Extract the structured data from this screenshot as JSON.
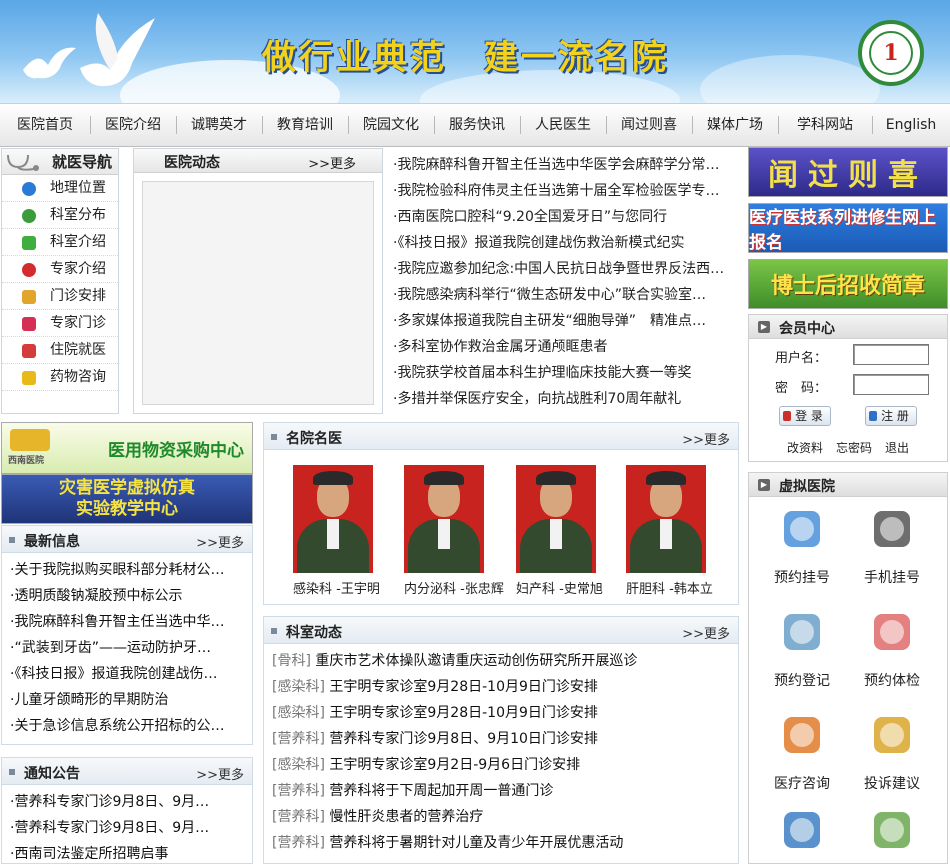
{
  "banner": {
    "slogan": "做行业典范　建一流名院"
  },
  "nav": [
    "医院首页",
    "医院介绍",
    "诚聘英才",
    "教育培训",
    "院园文化",
    "服务快讯",
    "人民医生",
    "闻过则喜",
    "媒体广场",
    "学科网站",
    "English"
  ],
  "sidebar": {
    "title": "就医导航",
    "items": [
      {
        "label": "地理位置",
        "icon": "globe-icon",
        "color": "#2b7ad6"
      },
      {
        "label": "科室分布",
        "icon": "dots-icon",
        "color": "#3a9c3a"
      },
      {
        "label": "科室介绍",
        "icon": "book-icon",
        "color": "#3fae3f"
      },
      {
        "label": "专家介绍",
        "icon": "cross-circle-icon",
        "color": "#d22c2c"
      },
      {
        "label": "门诊安排",
        "icon": "notepad-icon",
        "color": "#e0a52a"
      },
      {
        "label": "专家门诊",
        "icon": "heart-icon",
        "color": "#d62f55"
      },
      {
        "label": "住院就医",
        "icon": "hospital-icon",
        "color": "#d43b3b"
      },
      {
        "label": "药物咨询",
        "icon": "star-icon",
        "color": "#e8b918"
      }
    ]
  },
  "hospital_news": {
    "title": "医院动态",
    "more": ">>更多",
    "items": [
      "·我院麻醉科鲁开智主任当选中华医学会麻醉学分常…",
      "·我院检验科府伟灵主任当选第十届全军检验医学专…",
      "·西南医院口腔科“9.20全国爱牙日”与您同行",
      "·《科技日报》报道我院创建战伤救治新模式纪实",
      "·我院应邀参加纪念:中国人民抗日战争暨世界反法西…",
      "·我院感染病科举行“微生态研发中心”联合实验室…",
      "·多家媒体报道我院自主研发“细胞导弹”　精准点…",
      "·多科室协作救治金属牙通颅眶患者",
      "·我院获学校首届本科生护理临床技能大赛一等奖",
      "·多措并举保医疗安全，向抗战胜利70周年献礼"
    ]
  },
  "ads": {
    "wen": "闻过则喜",
    "jinxiu": "医疗医技系列进修生网上报名",
    "boshi": "博士后招收简章",
    "purchase": "医用物资采购中心",
    "purchase_logo": "西南医院",
    "virtual": "灾害医学虚拟仿真\n实验教学中心"
  },
  "member": {
    "title": "会员中心",
    "username_label": "用户名：",
    "password_label": "密　码：",
    "login": "登 录",
    "register": "注 册",
    "links": [
      "改资料",
      "忘密码",
      "退出"
    ]
  },
  "latest": {
    "title": "最新信息",
    "more": ">>更多",
    "items": [
      "·关于我院拟购买眼科部分耗材公…",
      "·透明质酸钠凝胶预中标公示",
      "·我院麻醉科鲁开智主任当选中华…",
      "·“武装到牙齿”——运动防护牙…",
      "·《科技日报》报道我院创建战伤…",
      "·儿童牙颌畸形的早期防治",
      "·关于急诊信息系统公开招标的公…"
    ]
  },
  "notice": {
    "title": "通知公告",
    "more": ">>更多",
    "items": [
      "·营养科专家门诊9月8日、9月…",
      "·营养科专家门诊9月8日、9月…",
      "·西南司法鉴定所招聘启事"
    ]
  },
  "famous": {
    "title": "名院名医",
    "more": ">>更多",
    "doctors": [
      "感染科 -王宇明",
      "内分泌科 -张忠辉",
      "妇产科 -史常旭",
      "肝胆科 -韩本立"
    ]
  },
  "dept_news": {
    "title": "科室动态",
    "more": ">>更多",
    "items": [
      {
        "tag": "[骨科]",
        "text": "重庆市艺术体操队邀请重庆运动创伤研究所开展巡诊"
      },
      {
        "tag": "[感染科]",
        "text": "王宇明专家诊室9月28日-10月9日门诊安排"
      },
      {
        "tag": "[感染科]",
        "text": "王宇明专家诊室9月28日-10月9日门诊安排"
      },
      {
        "tag": "[营养科]",
        "text": "营养科专家门诊9月8日、9月10日门诊安排"
      },
      {
        "tag": "[感染科]",
        "text": "王宇明专家诊室9月2日-9月6日门诊安排"
      },
      {
        "tag": "[营养科]",
        "text": "营养科将于下周起加开周一普通门诊"
      },
      {
        "tag": "[营养科]",
        "text": "慢性肝炎患者的营养治疗"
      },
      {
        "tag": "[营养科]",
        "text": "营养科将于暑期针对儿童及青少年开展优惠活动"
      }
    ]
  },
  "virtual_hospital": {
    "title": "虚拟医院",
    "items": [
      {
        "label": "预约挂号",
        "icon": "calendar-icon"
      },
      {
        "label": "手机挂号",
        "icon": "phone-icon"
      },
      {
        "label": "预约登记",
        "icon": "doctor-icon"
      },
      {
        "label": "预约体检",
        "icon": "nurse-icon"
      },
      {
        "label": "医疗咨询",
        "icon": "consult-icon"
      },
      {
        "label": "投诉建议",
        "icon": "pen-icon"
      },
      {
        "label": "",
        "icon": "computer-icon"
      },
      {
        "label": "",
        "icon": "magnifier-icon"
      }
    ]
  }
}
